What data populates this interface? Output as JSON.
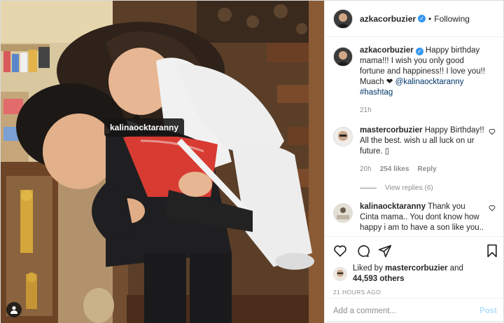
{
  "header": {
    "username": "azkacorbuzier",
    "separator": "•",
    "follow_state": "Following"
  },
  "photo": {
    "tag_label": "kalinaocktaranny",
    "user_tag_icon": "person-icon"
  },
  "comments": [
    {
      "username": "azkacorbuzier",
      "text": "Happy birthday mama!!! I wish you only good fortune and happiness!! I love you!! Muach ❤",
      "mention": "@kalinaocktaranny",
      "hashtag": "#hashtag",
      "time": "21h"
    },
    {
      "username": "mastercorbuzier",
      "text": "Happy Birthday!! All the best. wish u all luck on ur future. ▯",
      "time": "20h",
      "likes": "254 likes",
      "reply_label": "Reply",
      "view_replies": "View replies (6)"
    },
    {
      "username": "kalinaocktaranny",
      "text": "Thank you Cinta mama.. You dont know how happy i am to have a son like you.."
    }
  ],
  "actions": {
    "liked_by_prefix": "Liked by",
    "liked_by_user": "mastercorbuzier",
    "and_label": "and",
    "others_count": "44,593 others",
    "timestamp": "21 HOURS AGO"
  },
  "add_comment": {
    "placeholder": "Add a comment...",
    "post_label": "Post"
  },
  "colors": {
    "verified": "#3897f0",
    "link": "#00376b",
    "muted": "#8e8e8e",
    "post_disabled": "#b2dffc"
  }
}
